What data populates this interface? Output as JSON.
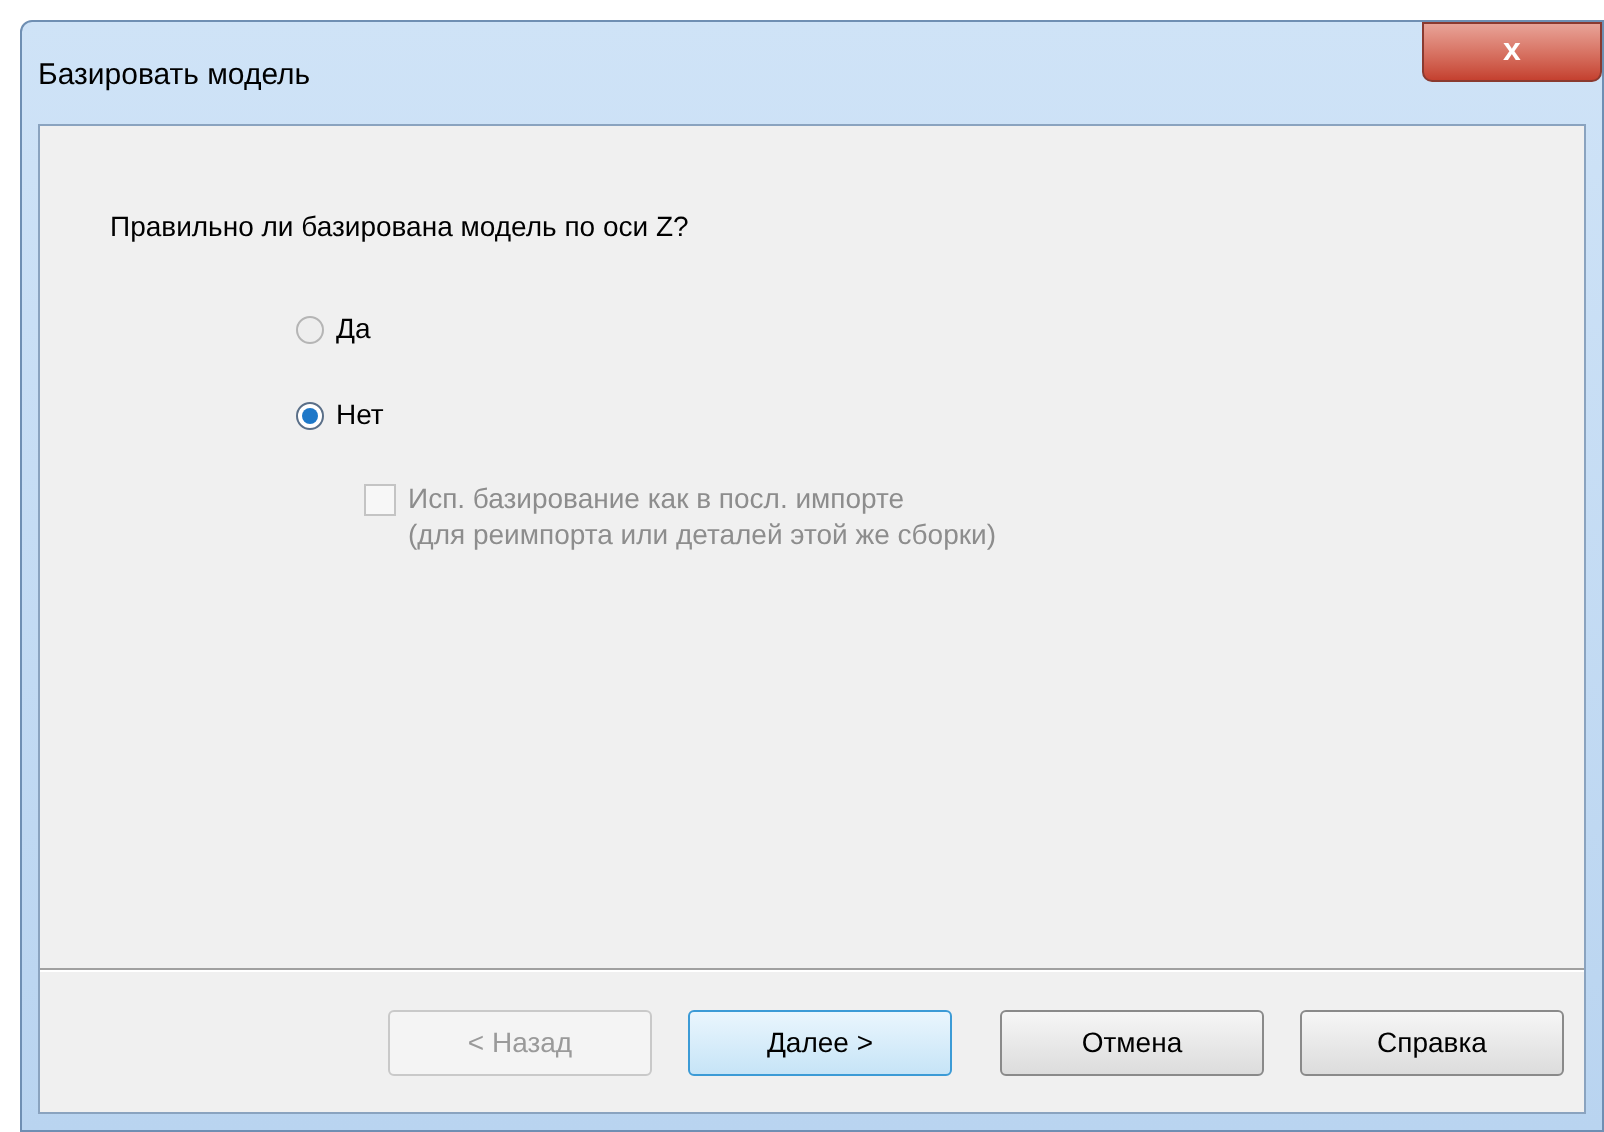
{
  "window": {
    "title": "Базировать модель",
    "close": "x"
  },
  "question": "Правильно ли базирована модель по оси Z?",
  "options": [
    {
      "label": "Да",
      "selected": false
    },
    {
      "label": "Нет",
      "selected": true
    }
  ],
  "reuse_checkbox": {
    "lines": [
      "Исп. базирование как в посл. импорте",
      "(для реимпорта или деталей этой же сборки)"
    ],
    "checked": false,
    "disabled": true
  },
  "buttons": [
    {
      "label": "< Назад",
      "disabled": true,
      "default": false
    },
    {
      "label": "Далее >",
      "disabled": false,
      "default": true
    },
    {
      "label": "Отмена",
      "disabled": false,
      "default": false
    },
    {
      "label": "Справка",
      "disabled": false,
      "default": false
    }
  ]
}
